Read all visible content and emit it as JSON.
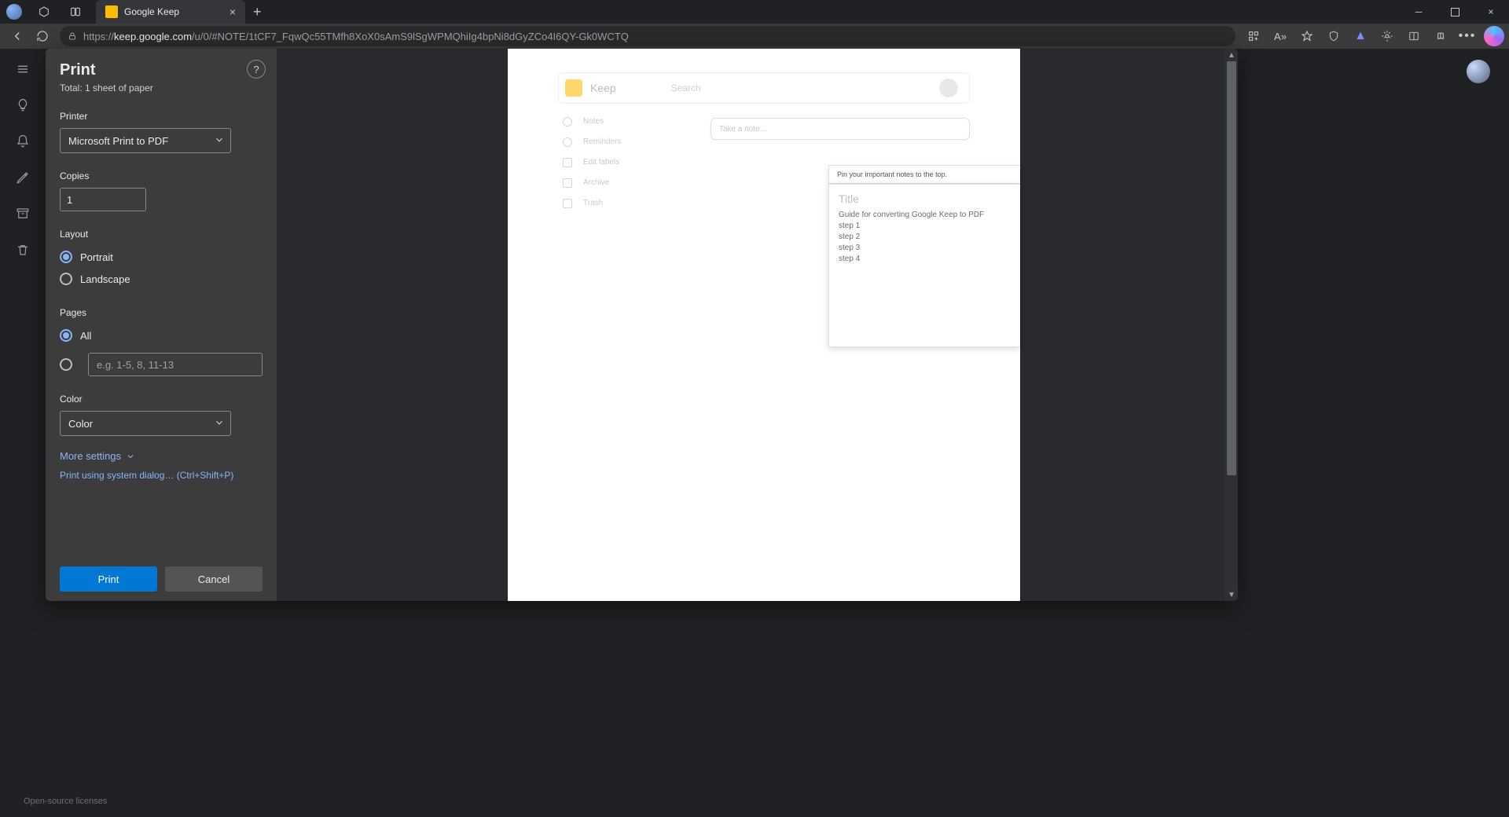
{
  "browser": {
    "tab_title": "Google Keep",
    "url_dim_prefix": "https://",
    "url_host": "keep.google.com",
    "url_path": "/u/0/#NOTE/1tCF7_FqwQc55TMfh8XoX0sAmS9lSgWPMQhiIg4bpNi8dGyZCo4I6QY-Gk0WCTQ"
  },
  "print": {
    "title": "Print",
    "total": "Total: 1 sheet of paper",
    "printer_label": "Printer",
    "printer_value": "Microsoft Print to PDF",
    "copies_label": "Copies",
    "copies_value": "1",
    "layout_label": "Layout",
    "layout_options": {
      "portrait": "Portrait",
      "landscape": "Landscape"
    },
    "pages_label": "Pages",
    "pages_all": "All",
    "pages_placeholder": "e.g. 1-5, 8, 11-13",
    "color_label": "Color",
    "color_value": "Color",
    "more_settings": "More settings",
    "system_dialog": "Print using system dialog… (Ctrl+Shift+P)",
    "print_btn": "Print",
    "cancel_btn": "Cancel"
  },
  "preview": {
    "keep_name": "Keep",
    "keep_search": "Search",
    "take_note": "Take a note…",
    "nav": [
      "Notes",
      "Reminders",
      "Edit labels",
      "Archive",
      "Trash"
    ],
    "tooltip": "Pin your important notes to the top.",
    "note_title": "Title",
    "note_heading": "Guide for converting Google Keep to PDF",
    "note_steps": [
      "step 1",
      "step 2",
      "step 3",
      "step 4"
    ]
  },
  "footer": {
    "open_source": "Open-source licenses"
  }
}
